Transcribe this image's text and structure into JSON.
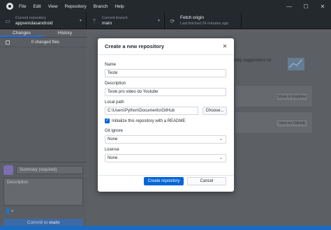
{
  "menu": {
    "items": [
      "File",
      "Edit",
      "View",
      "Repository",
      "Branch",
      "Help"
    ]
  },
  "window_controls": {
    "minimize": "—",
    "maximize": "☐",
    "close": "✕"
  },
  "toolbar": {
    "repo_label": "Current repository",
    "repo_value": "appvendasandroid",
    "branch_label": "Current branch",
    "branch_value": "main",
    "fetch_label": "Fetch origin",
    "fetch_value": "Last fetched 24 minutes ago"
  },
  "sidebar": {
    "tabs": [
      "Changes",
      "History"
    ],
    "changed_files": "0 changed files",
    "summary_placeholder": "Summary (required)",
    "description_placeholder": "Description",
    "commit_prefix": "Commit to",
    "commit_branch": "main"
  },
  "background": {
    "suggestions_text": "riendly suggestions for",
    "explorer_button": "Show in Explorer",
    "github_button": "View on GitHub"
  },
  "modal": {
    "title": "Create a new repository",
    "name_label": "Name",
    "name_value": "Teste",
    "description_label": "Description",
    "description_value": "Teste pro video do Youtube",
    "path_label": "Local path",
    "path_value": "C:\\Users\\Python\\Documents\\GitHub",
    "choose_button": "Choose...",
    "readme_label": "Initialize this repository with a README",
    "gitignore_label": "Git ignore",
    "gitignore_value": "None",
    "license_label": "License",
    "license_value": "None",
    "create_button": "Create repository",
    "cancel_button": "Cancel"
  },
  "colors": {
    "accent": "#0366d6",
    "titlebar": "#24292e",
    "overlay": "#5c5f64"
  }
}
